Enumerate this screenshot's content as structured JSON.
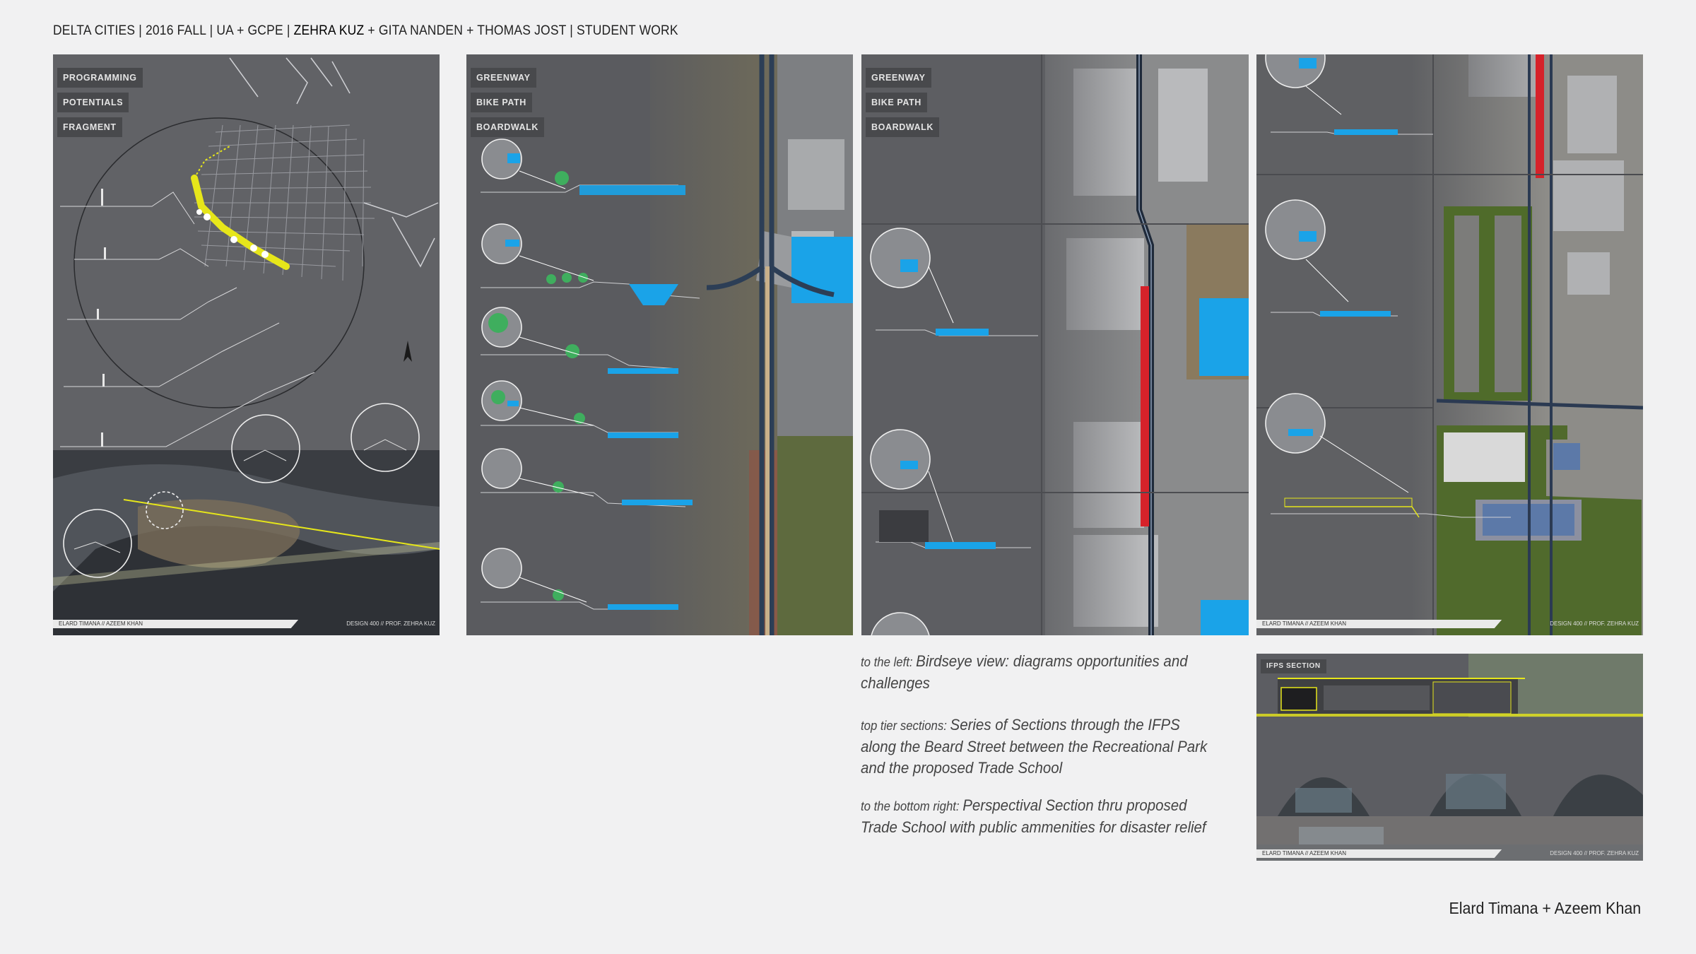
{
  "header": {
    "part1": "DELTA CITIES  |  2016 FALL  |  UA + GCPE  |  ",
    "highlight": "ZEHRA KUZ",
    "part2": " + GITA NANDEN + THOMAS JOST  |  STUDENT WORK"
  },
  "panels": {
    "p1": {
      "tags": [
        "PROGRAMMING",
        "POTENTIALS",
        "FRAGMENT"
      ],
      "footer_left": "ELARD TIMANA // AZEEM KHAN",
      "footer_right": "DESIGN 400 // PROF. ZEHRA KUZ"
    },
    "p2": {
      "tags": [
        "GREENWAY",
        "BIKE PATH",
        "BOARDWALK"
      ]
    },
    "p3": {
      "tags": [
        "GREENWAY",
        "BIKE PATH",
        "BOARDWALK"
      ]
    },
    "p4": {
      "footer_left": "ELARD TIMANA // AZEEM KHAN",
      "footer_right": "DESIGN 400 // PROF. ZEHRA KUZ"
    },
    "p5": {
      "tag": "IFPS SECTION",
      "footer_left": "ELARD TIMANA // AZEEM KHAN",
      "footer_right": "DESIGN 400 // PROF. ZEHRA KUZ"
    }
  },
  "captions": [
    {
      "lead": "to the left: ",
      "text": "Birdseye view: diagrams opportunities and challenges"
    },
    {
      "lead": "top tier sections: ",
      "text": "Series of Sections through the IFPS along the Beard Street between the Recreational Park and the proposed Trade School"
    },
    {
      "lead": "to the bottom right: ",
      "text": "Perspectival Section thru proposed Trade School with public ammenities for disaster relief"
    }
  ],
  "credit": "Elard Timana + Azeem Khan",
  "colors": {
    "background": "#f1f1f2",
    "panel_gray": "#5f6064",
    "water_blue": "#1aa3e8",
    "highlight_yellow": "#e6e61a",
    "rail_red": "#d6222a",
    "park_green": "#4f6b2a"
  }
}
